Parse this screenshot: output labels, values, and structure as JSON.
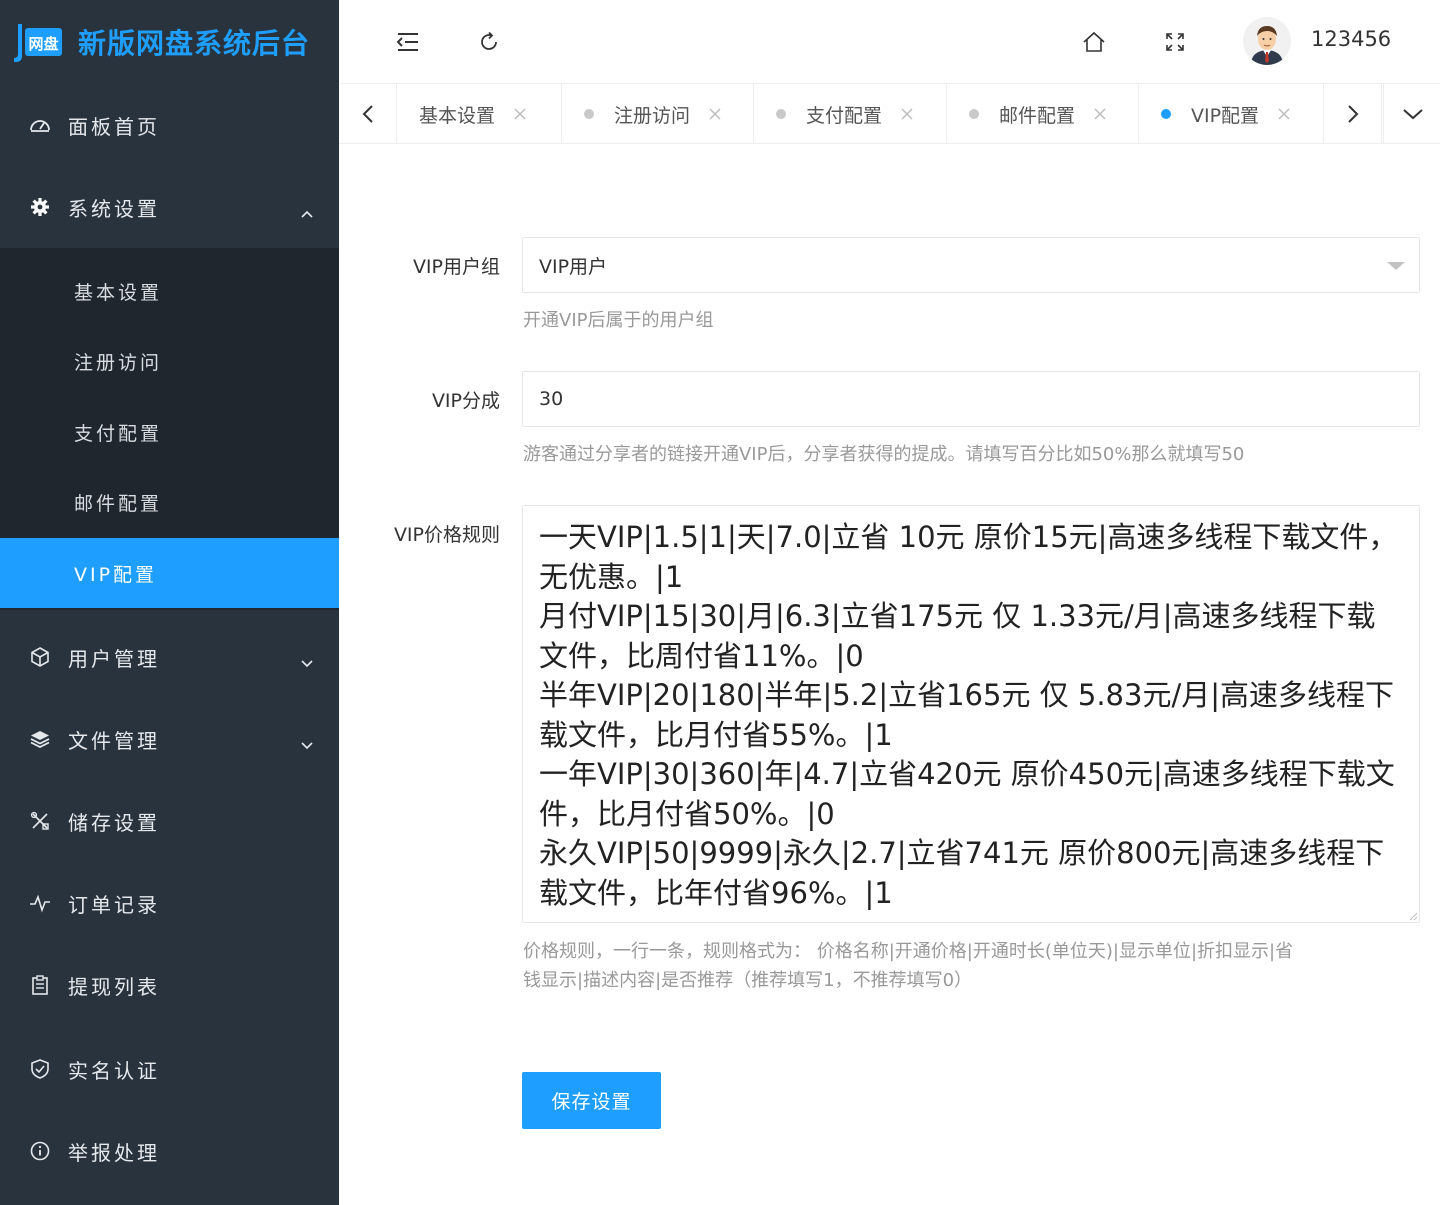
{
  "app": {
    "logo_text": "新版网盘系统后台",
    "logo_mark_text": "网盘"
  },
  "sidebar": {
    "items": [
      {
        "label": "面板首页",
        "icon": "dashboard-icon"
      },
      {
        "label": "系统设置",
        "icon": "gear-icon",
        "expanded": true
      },
      {
        "label": "用户管理",
        "icon": "cube-icon"
      },
      {
        "label": "文件管理",
        "icon": "layers-icon"
      },
      {
        "label": "储存设置",
        "icon": "tools-icon"
      },
      {
        "label": "订单记录",
        "icon": "pulse-icon"
      },
      {
        "label": "提现列表",
        "icon": "clipboard-icon"
      },
      {
        "label": "实名认证",
        "icon": "shield-icon"
      },
      {
        "label": "举报处理",
        "icon": "info-icon"
      }
    ],
    "submenu": [
      {
        "label": "基本设置"
      },
      {
        "label": "注册访问"
      },
      {
        "label": "支付配置"
      },
      {
        "label": "邮件配置"
      },
      {
        "label": "VIP配置",
        "active": true
      }
    ]
  },
  "header": {
    "username": "123456"
  },
  "tabs": [
    {
      "label": "基本设置"
    },
    {
      "label": "注册访问"
    },
    {
      "label": "支付配置"
    },
    {
      "label": "邮件配置"
    },
    {
      "label": "VIP配置",
      "active": true
    }
  ],
  "form": {
    "vip_group": {
      "label": "VIP用户组",
      "value": "VIP用户",
      "help": "开通VIP后属于的用户组"
    },
    "vip_share": {
      "label": "VIP分成",
      "value": "30",
      "help": "游客通过分享者的链接开通VIP后，分享者获得的提成。请填写百分比如50%那么就填写50"
    },
    "vip_rules": {
      "label": "VIP价格规则",
      "value": "一天VIP|1.5|1|天|7.0|立省 10元 原价15元|高速多线程下载文件，无优惠。|1\n月付VIP|15|30|月|6.3|立省175元 仅 1.33元/月|高速多线程下载文件，比周付省11%。|0\n半年VIP|20|180|半年|5.2|立省165元 仅 5.83元/月|高速多线程下载文件，比月付省55%。|1\n一年VIP|30|360|年|4.7|立省420元 原价450元|高速多线程下载文件，比月付省50%。|0\n永久VIP|50|9999|永久|2.7|立省741元 原价800元|高速多线程下载文件，比年付省96%。|1",
      "help_line1": "价格规则，一行一条，规则格式为： 价格名称|开通价格|开通时长(单位天)|显示单位|折扣显示|省",
      "help_line2": "钱显示|描述内容|是否推荐（推荐填写1，不推荐填写0）"
    },
    "save_label": "保存设置"
  },
  "colors": {
    "sidebar_bg": "#28333e",
    "submenu_bg": "#1f262d",
    "accent": "#1e9fff"
  }
}
